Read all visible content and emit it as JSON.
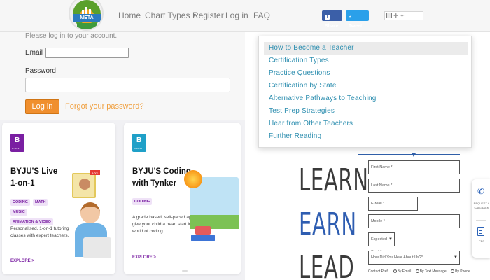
{
  "header": {
    "logo_text": "META",
    "nav": {
      "home": "Home",
      "chart_types": "Chart Types",
      "register": "Register",
      "login": "Log in",
      "faq": "FAQ"
    },
    "share_label": "Share",
    "tweet_label": "Tweet"
  },
  "login": {
    "hint": "Please log in to your account.",
    "email_label": "Email",
    "email_value": "",
    "password_label": "Password",
    "password_value": "",
    "login_button": "Log in",
    "forgot_link": "Forgot your password?"
  },
  "cards": [
    {
      "brand": "BYJU'S",
      "title_line1": "BYJU'S Live",
      "title_line2": "1-on-1",
      "chips": [
        "CODING",
        "MATH",
        "MUSIC",
        "ANIMATION & VIDEO"
      ],
      "live_badge": "LIVE",
      "description": "Personalised, 1-on-1 tutoring classes with expert teachers.",
      "explore": "EXPLORE >"
    },
    {
      "brand": "CODING",
      "title_line1": "BYJU'S Coding",
      "title_line2": "with Tynker",
      "chips": [
        "CODING"
      ],
      "description": "A grade based, self-paced app to give your child a head start in the world of coding.",
      "explore": "EXPLORE >"
    }
  ],
  "dropdown": {
    "items": [
      "How to Become a Teacher",
      "Certification Types",
      "Practice Questions",
      "Certification by State",
      "Alternative Pathways to Teaching",
      "Test Prep Strategies",
      "Hear from Other Teachers",
      "Further Reading"
    ],
    "active_index": 0
  },
  "promo": {
    "words": [
      "LEARN",
      "EARN",
      "LEAD"
    ],
    "colors": {
      "learn": "#3a3a3a",
      "earn": "#2e5db1",
      "lead": "#3a3a3a"
    }
  },
  "form": {
    "first_name": "First Name *",
    "last_name": "Last Name *",
    "email": "E-Mail *",
    "mobile": "Mobile *",
    "expected_start": "Expected Start *",
    "heard_about": "How Did You Hear About Us?*",
    "contact_label": "Contact Pref",
    "contact_options": [
      "By Email",
      "By Text Message",
      "By Phone"
    ]
  },
  "side_widget": {
    "request_label": "REQUEST A CALLBACK",
    "pdf_label": "PDF"
  },
  "accent_colors": {
    "orange": "#f08f2e",
    "link_blue": "#2f8fb0",
    "purple": "#7a1fa2",
    "facebook": "#3b5fa8",
    "twitter": "#2aa0ea"
  }
}
